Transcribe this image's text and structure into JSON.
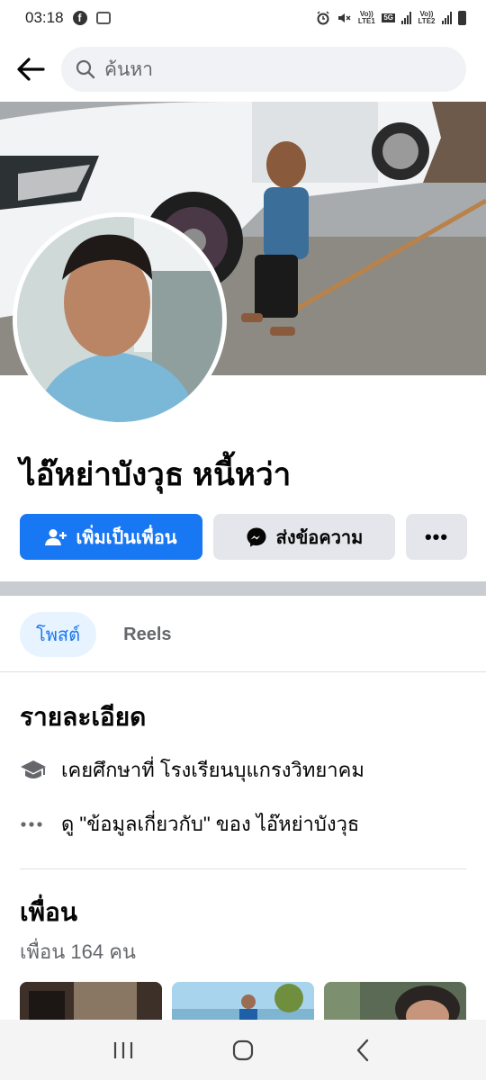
{
  "status_bar": {
    "time": "03:18",
    "network_1": "Vo)) LTE1",
    "network_5g": "5G",
    "network_2": "Vo)) LTE2"
  },
  "search": {
    "placeholder": "ค้นหา"
  },
  "profile": {
    "name": "ไอ๊หย่าบังวุธ หนี้หว่า"
  },
  "actions": {
    "add_friend_label": "เพิ่มเป็นเพื่อน",
    "message_label": "ส่งข้อความ",
    "more_label": "•••"
  },
  "tabs": {
    "posts": "โพสต์",
    "reels": "Reels"
  },
  "details": {
    "title": "รายละเอียด",
    "education": "เคยศึกษาที่ โรงเรียนบุแกรงวิทยาคม",
    "about": "ดู \"ข้อมูลเกี่ยวกับ\" ของ ไอ๊หย่าบังวุธ"
  },
  "friends": {
    "title": "เพื่อน",
    "count_text": "เพื่อน 164 คน"
  },
  "colors": {
    "brand_blue": "#1877f2",
    "button_gray": "#e4e6eb",
    "tab_active_bg": "#e7f3ff"
  }
}
